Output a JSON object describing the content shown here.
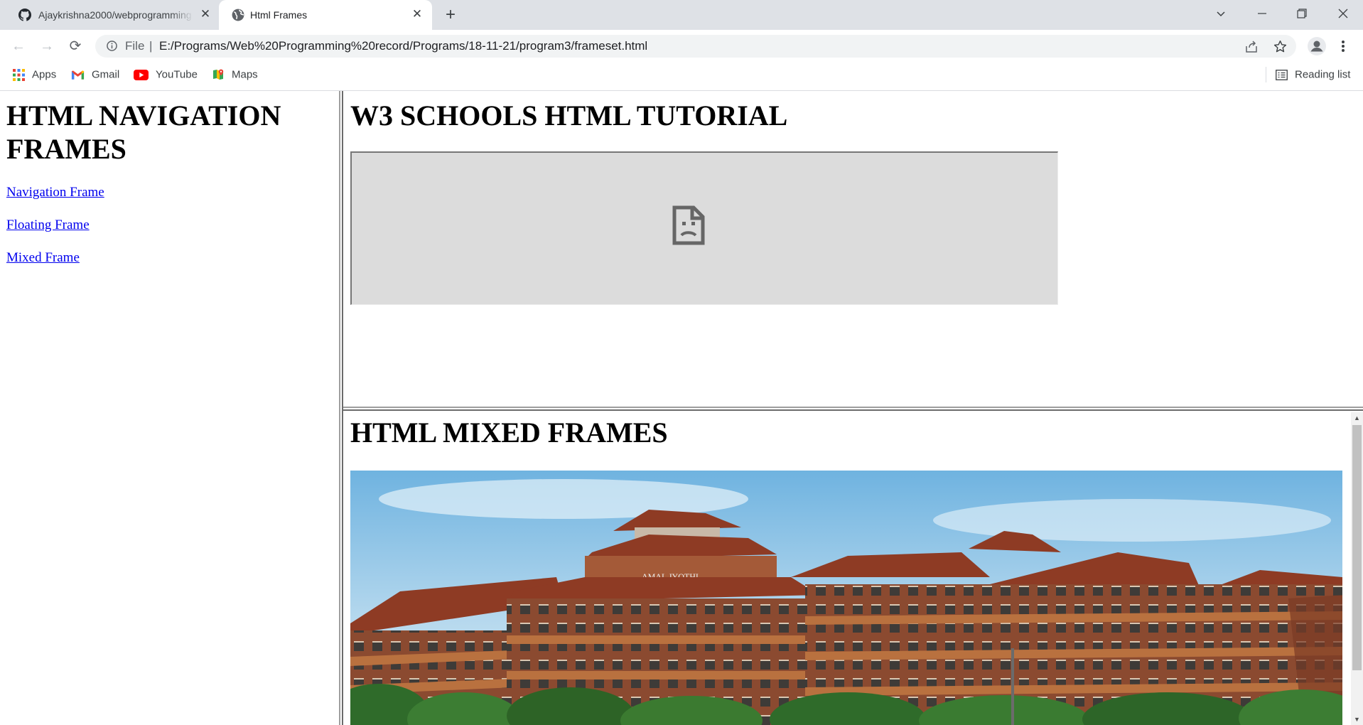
{
  "browser": {
    "tabs": [
      {
        "title": "Ajaykrishna2000/webprogramming",
        "favicon": "github-icon",
        "active": false
      },
      {
        "title": "Html Frames",
        "favicon": "globe-icon",
        "active": true
      }
    ],
    "new_tab_symbol": "+",
    "window_controls": {
      "tab_search": "⌄",
      "minimize": "—",
      "restore": "❐",
      "close": "✕"
    },
    "toolbar": {
      "back": "←",
      "forward": "→",
      "reload": "⟳",
      "scheme_label": "File",
      "separator": "|",
      "url": "E:/Programs/Web%20Programming%20record/Programs/18-11-21/program3/frameset.html"
    },
    "bookmarks": [
      {
        "label": "Apps",
        "icon": "apps-grid-icon"
      },
      {
        "label": "Gmail",
        "icon": "gmail-icon"
      },
      {
        "label": "YouTube",
        "icon": "youtube-icon"
      },
      {
        "label": "Maps",
        "icon": "maps-icon"
      }
    ],
    "reading_list_label": "Reading list"
  },
  "left_frame": {
    "heading": "HTML NAVIGATION FRAMES",
    "links": [
      "Navigation Frame",
      "Floating Frame",
      "Mixed Frame"
    ]
  },
  "top_right_frame": {
    "heading": "W3 SCHOOLS HTML TUTORIAL",
    "iframe_status_icon": "broken-page-icon"
  },
  "bottom_right_frame": {
    "heading": "HTML MIXED FRAMES",
    "image_subject": "college-building-photo",
    "building_sign": "AMAL JYOTHI COLLEGE OF ENGINEERING"
  },
  "colors": {
    "tabstrip": "#dee1e6",
    "omnibox": "#f1f3f4",
    "link": "#0000ee",
    "broken_frame_bg": "#dcdcdc",
    "sky": "#8fc3e6",
    "roof": "#8e3b24"
  }
}
